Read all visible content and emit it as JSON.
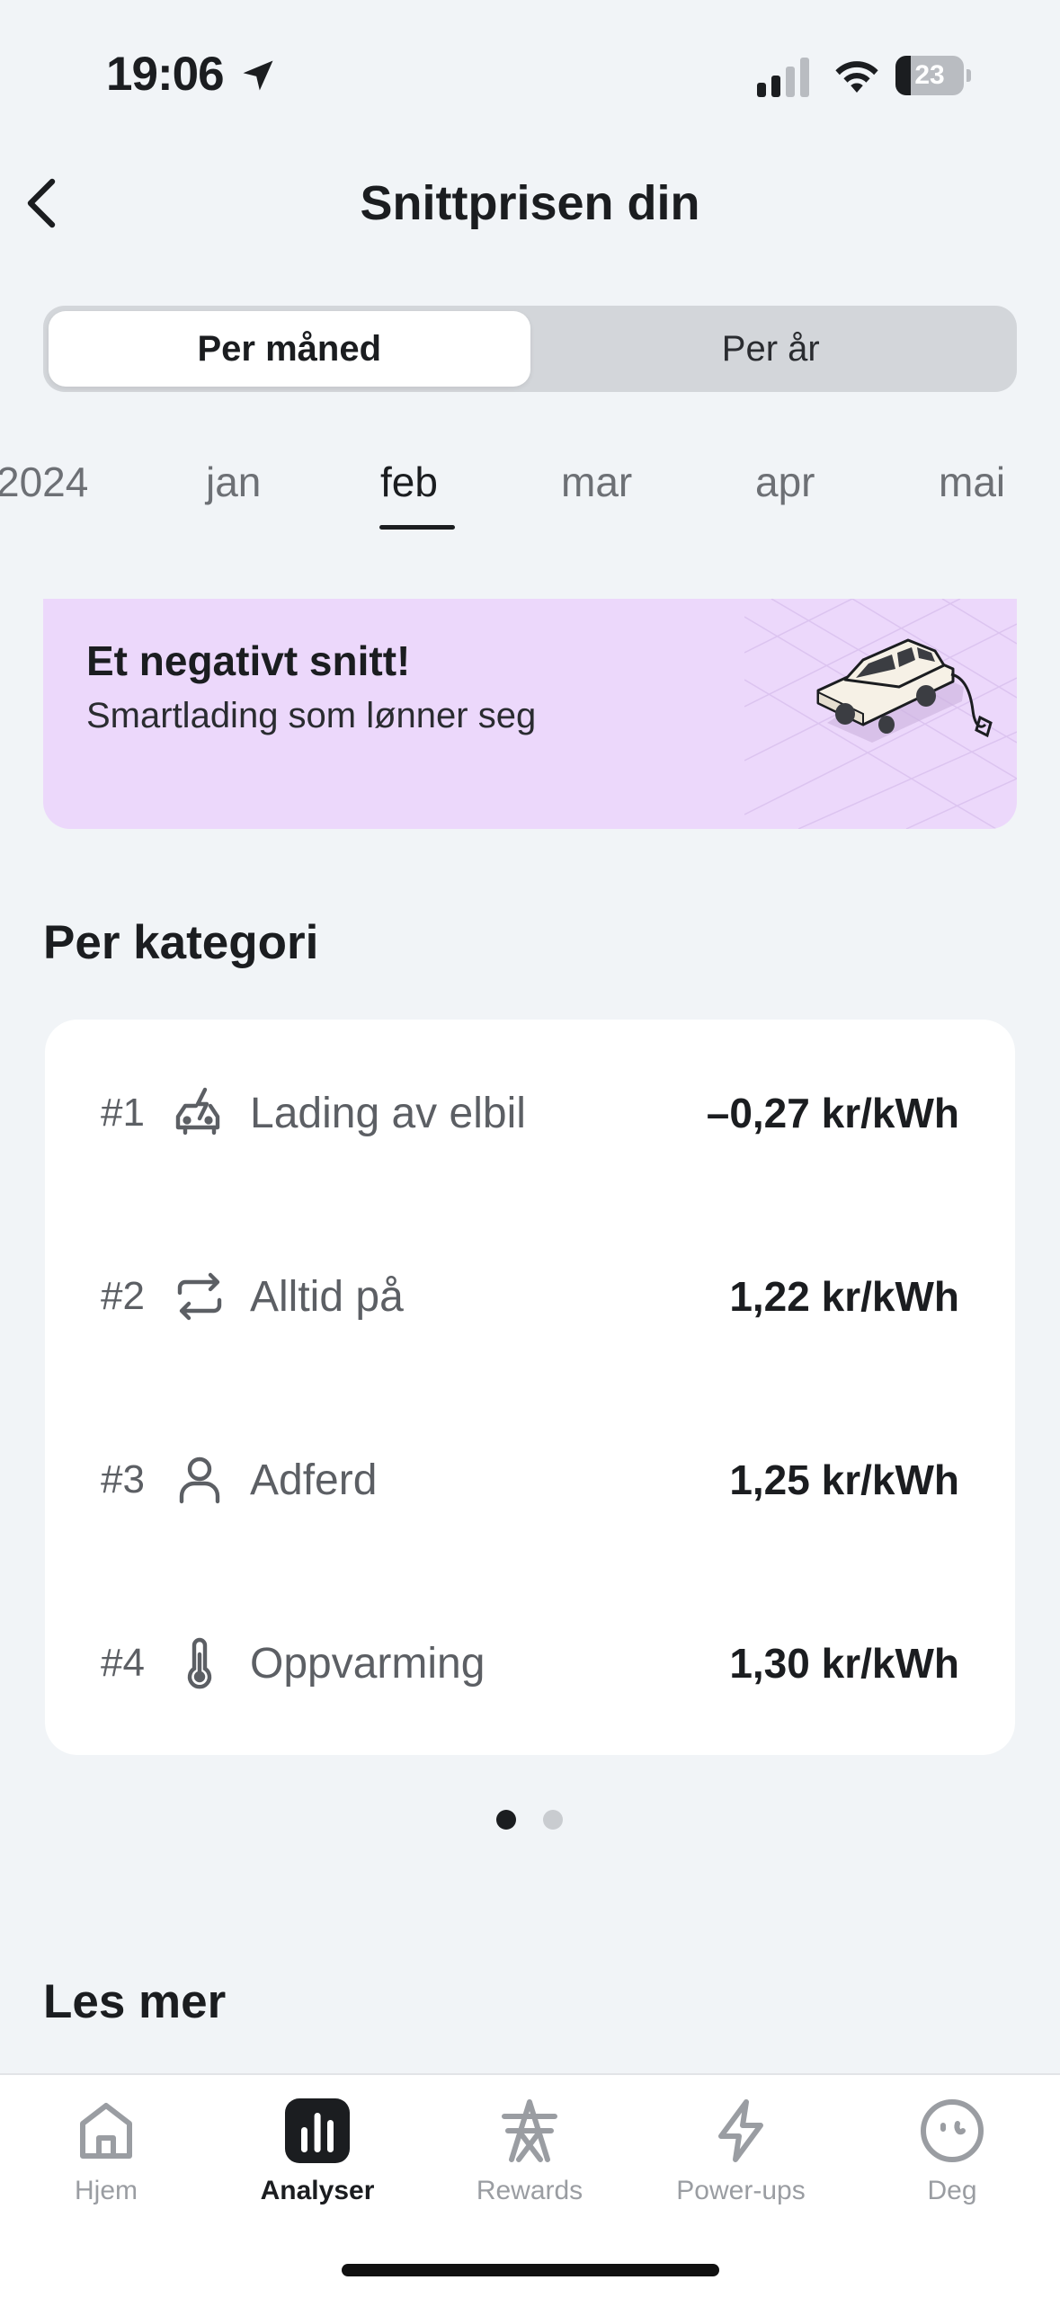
{
  "status": {
    "time": "19:06",
    "battery": "23",
    "battery_level": 0.23
  },
  "header": {
    "title": "Snittprisen din"
  },
  "period_toggle": {
    "options": [
      "Per måned",
      "Per år"
    ],
    "selected": "Per måned"
  },
  "months": [
    "2024",
    "jan",
    "feb",
    "mar",
    "apr",
    "mai"
  ],
  "selected_month": "feb",
  "promo": {
    "title": "Et negativt snitt!",
    "subtitle": "Smartlading som lønner seg"
  },
  "category": {
    "title": "Per kategori",
    "rows": [
      {
        "rank": "#1",
        "icon": "car-charging-icon",
        "label": "Lading av elbil",
        "value": "–0,27 kr/kWh"
      },
      {
        "rank": "#2",
        "icon": "repeat-icon",
        "label": "Alltid på",
        "value": "1,22 kr/kWh"
      },
      {
        "rank": "#3",
        "icon": "person-icon",
        "label": "Adferd",
        "value": "1,25 kr/kWh"
      },
      {
        "rank": "#4",
        "icon": "thermometer-icon",
        "label": "Oppvarming",
        "value": "1,30 kr/kWh"
      }
    ],
    "pages": 2,
    "current_page": 1
  },
  "read_more": {
    "title": "Les mer"
  },
  "nav": {
    "items": [
      {
        "label": "Hjem",
        "icon": "home-icon"
      },
      {
        "label": "Analyser",
        "icon": "bar-chart-icon"
      },
      {
        "label": "Rewards",
        "icon": "power-pylon-icon"
      },
      {
        "label": "Power-ups",
        "icon": "lightning-icon"
      },
      {
        "label": "Deg",
        "icon": "face-icon"
      }
    ],
    "active": "Analyser"
  },
  "colors": {
    "background": "#f1f4f7",
    "promo": "#ecd8fb",
    "text": "#1b1d20",
    "muted": "#5c5f64",
    "nav_inactive": "#9a9da2"
  }
}
